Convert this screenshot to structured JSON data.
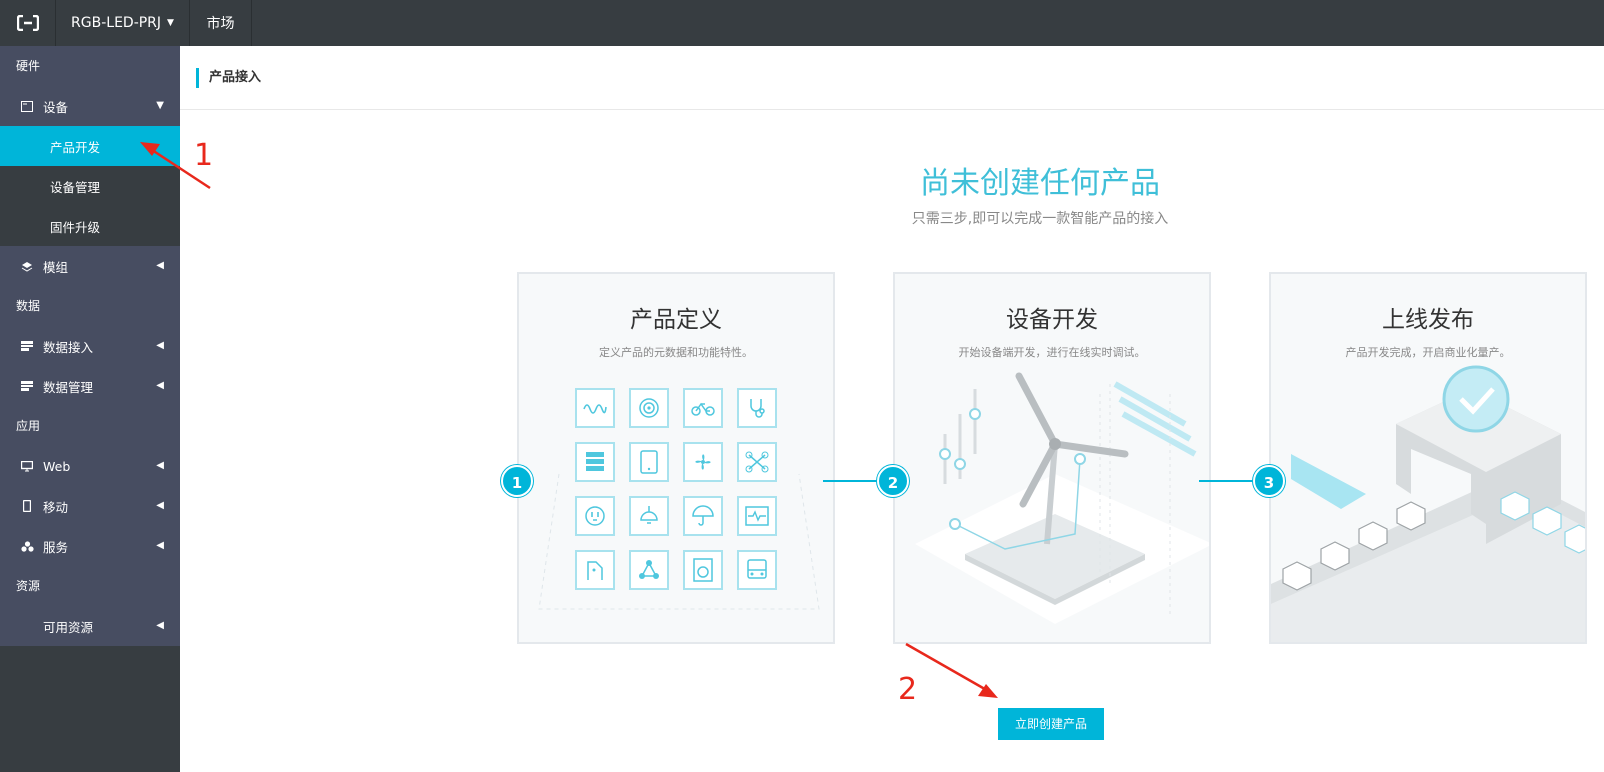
{
  "topbar": {
    "logo_icon": "aliyun-logo-icon",
    "project": "RGB-LED-PRJ",
    "market": "市场"
  },
  "sidebar": {
    "sections": [
      {
        "label": "硬件"
      },
      {
        "label": "数据"
      },
      {
        "label": "应用"
      },
      {
        "label": "资源"
      }
    ],
    "device": "设备",
    "product_dev": "产品开发",
    "device_mgmt": "设备管理",
    "firmware": "固件升级",
    "module": "模组",
    "data_access": "数据接入",
    "data_mgmt": "数据管理",
    "web": "Web",
    "mobile": "移动",
    "service": "服务",
    "resources": "可用资源"
  },
  "main": {
    "breadcrumb": "产品接入",
    "hero_title": "尚未创建任何产品",
    "hero_subtitle": "只需三步,即可以完成一款智能产品的接入",
    "cards": [
      {
        "title": "产品定义",
        "desc": "定义产品的元数据和功能特性。"
      },
      {
        "title": "设备开发",
        "desc": "开始设备端开发，进行在线实时调试。"
      },
      {
        "title": "上线发布",
        "desc": "产品开发完成，开启商业化量产。"
      }
    ],
    "steps": [
      "1",
      "2",
      "3"
    ],
    "create_button": "立即创建产品"
  },
  "annotations": [
    "1",
    "2"
  ],
  "colors": {
    "accent": "#00b5d9",
    "topbar": "#373d41",
    "sidebar_top": "#474d61",
    "annotation": "#e8281c"
  }
}
